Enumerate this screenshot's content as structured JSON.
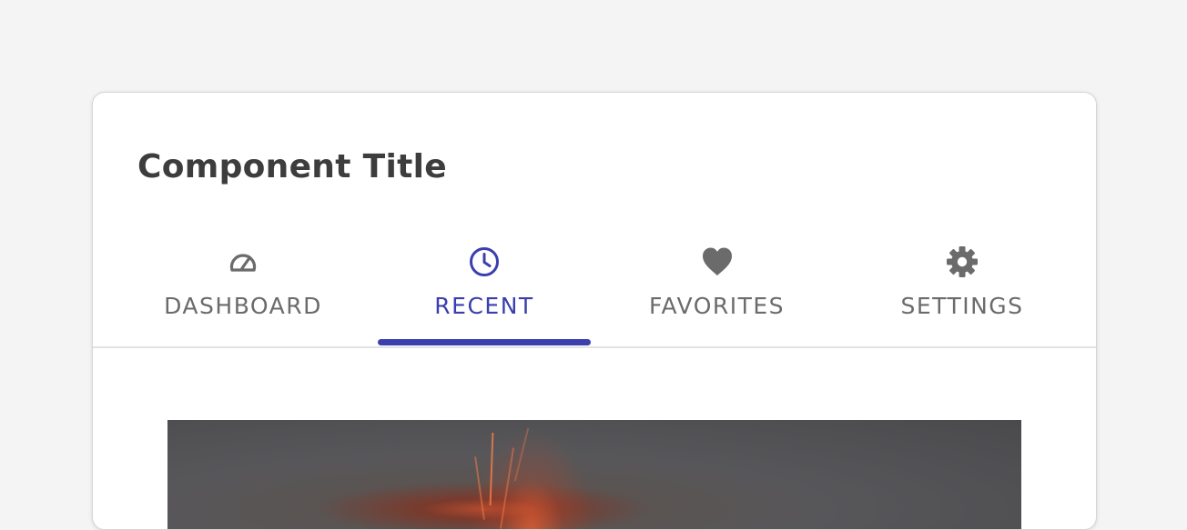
{
  "card": {
    "title": "Component Title"
  },
  "tabs": [
    {
      "label": "DASHBOARD",
      "icon": "speedometer-icon",
      "active": false
    },
    {
      "label": "RECENT",
      "icon": "clock-icon",
      "active": true
    },
    {
      "label": "FAVORITES",
      "icon": "heart-icon",
      "active": false
    },
    {
      "label": "SETTINGS",
      "icon": "gear-icon",
      "active": false
    }
  ],
  "colors": {
    "accent": "#3a3fad",
    "inactive_tab": "#6b6b6b",
    "title": "#3d3d3d",
    "page_background": "#f4f4f4",
    "card_background": "#ffffff"
  },
  "media": {
    "subject": "volcano-eruption-image"
  }
}
